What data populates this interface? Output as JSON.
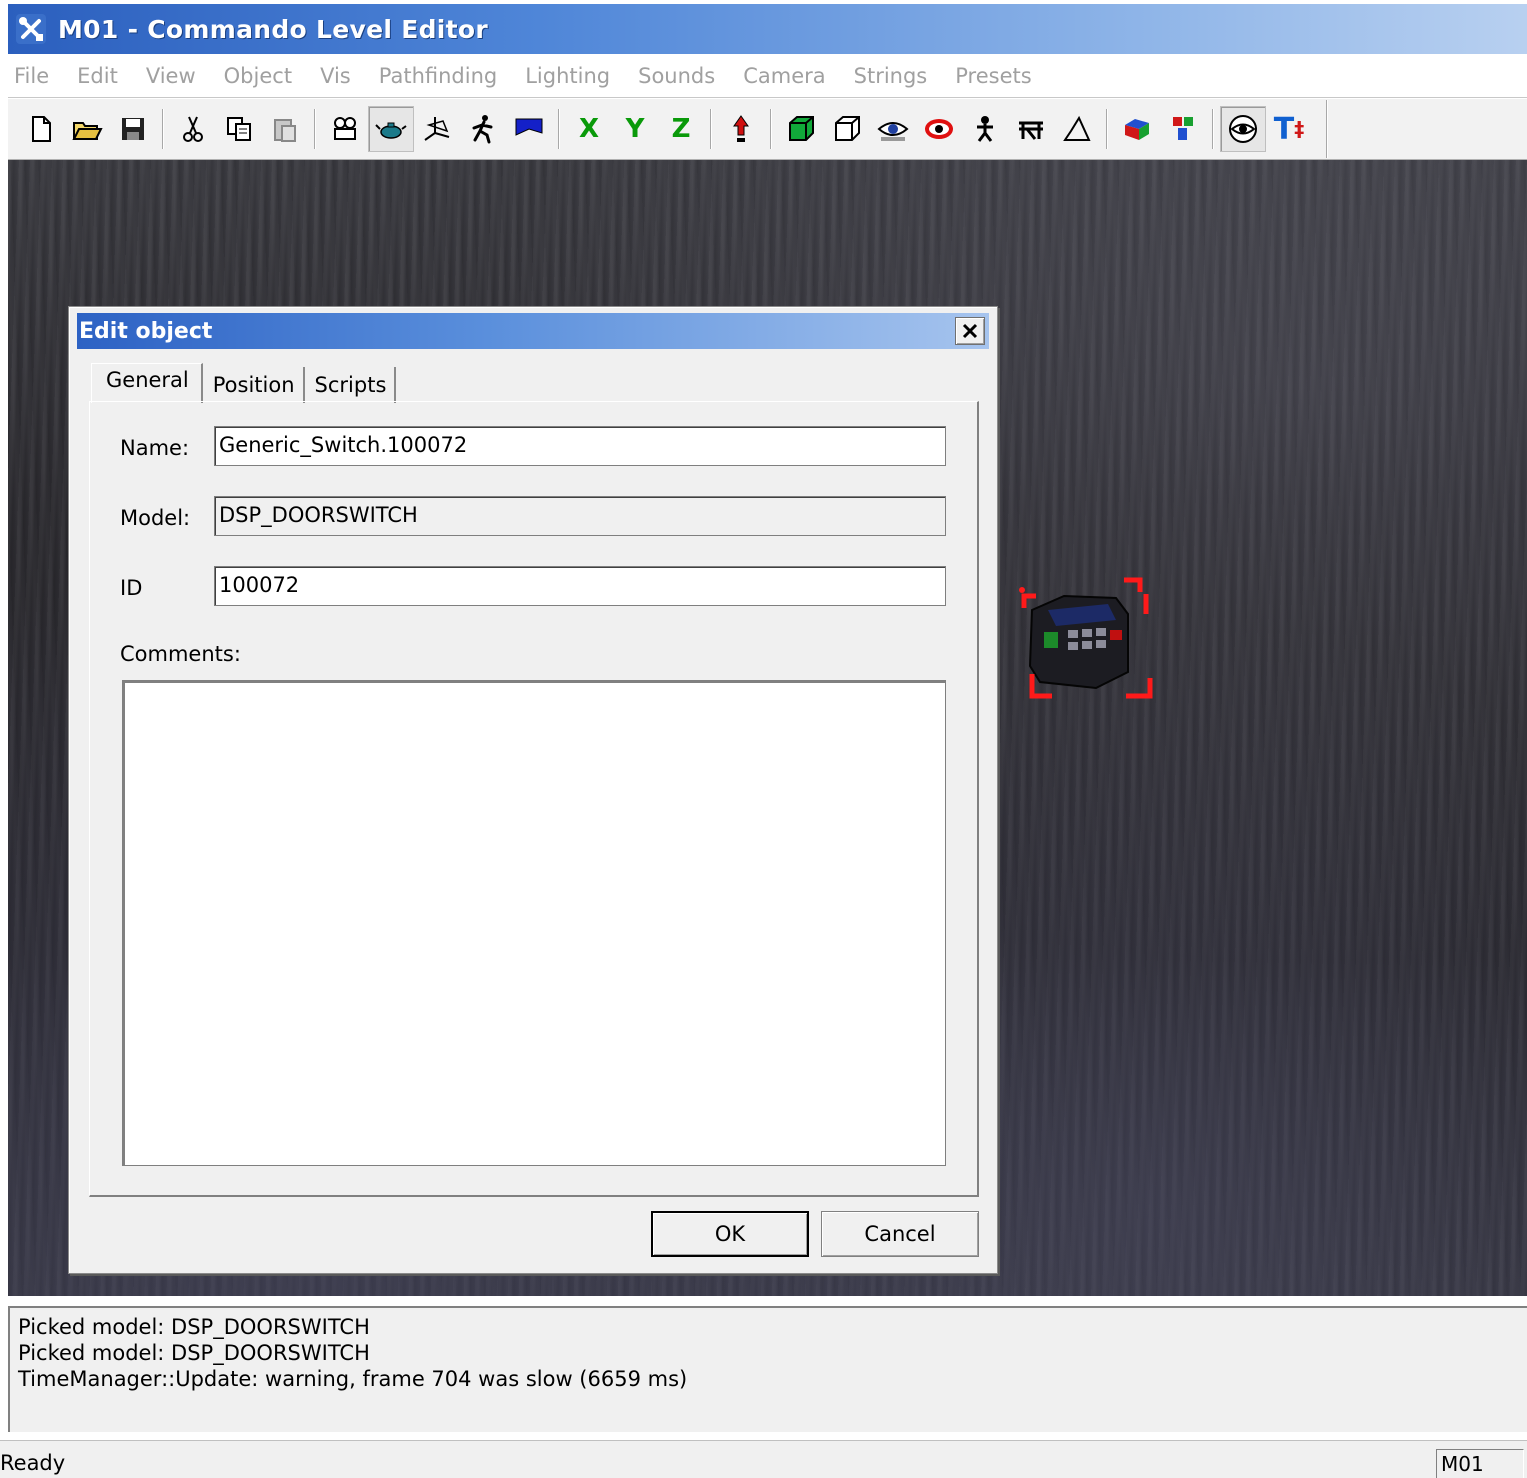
{
  "window": {
    "title": "M01  - Commando Level Editor",
    "app_icon": "tools-icon"
  },
  "menu": [
    "File",
    "Edit",
    "View",
    "Object",
    "Vis",
    "Pathfinding",
    "Lighting",
    "Sounds",
    "Camera",
    "Strings",
    "Presets"
  ],
  "toolbar": {
    "axis_x": "X",
    "axis_y": "Y",
    "axis_z": "Z",
    "text_tool": "T",
    "icons": [
      "new-file-icon",
      "open-folder-icon",
      "save-icon",
      "cut-icon",
      "copy-icon",
      "paste-icon",
      "camera-icon",
      "teapot-icon",
      "axes-icon",
      "walk-icon",
      "flag-icon",
      "lock-x-icon",
      "lock-y-icon",
      "lock-z-icon",
      "drop-icon",
      "solid-cube-icon",
      "wire-cube-icon",
      "eye-icon",
      "red-eye-icon",
      "person-icon",
      "bench-icon",
      "shape-icon",
      "color-cube-icon",
      "blocks-icon",
      "visibility-icon",
      "text-icon"
    ]
  },
  "dialog": {
    "title": "Edit object",
    "tabs": [
      "General",
      "Position",
      "Scripts"
    ],
    "active_tab": "General",
    "fields": {
      "name_label": "Name:",
      "name_value": "Generic_Switch.100072",
      "model_label": "Model:",
      "model_value": "DSP_DOORSWITCH",
      "id_label": "ID",
      "id_value": "100072",
      "comments_label": "Comments:",
      "comments_value": ""
    },
    "buttons": {
      "ok": "OK",
      "cancel": "Cancel"
    }
  },
  "log": [
    "Picked model: DSP_DOORSWITCH",
    "Picked model: DSP_DOORSWITCH",
    "TimeManager::Update: warning, frame 704 was slow (6659 ms)"
  ],
  "status": {
    "text": "Ready",
    "level": "M01"
  },
  "colors": {
    "titlebar": "#2b5fbe",
    "selection": "#ff1a1a",
    "axis_lock": "#0a9a0a"
  }
}
